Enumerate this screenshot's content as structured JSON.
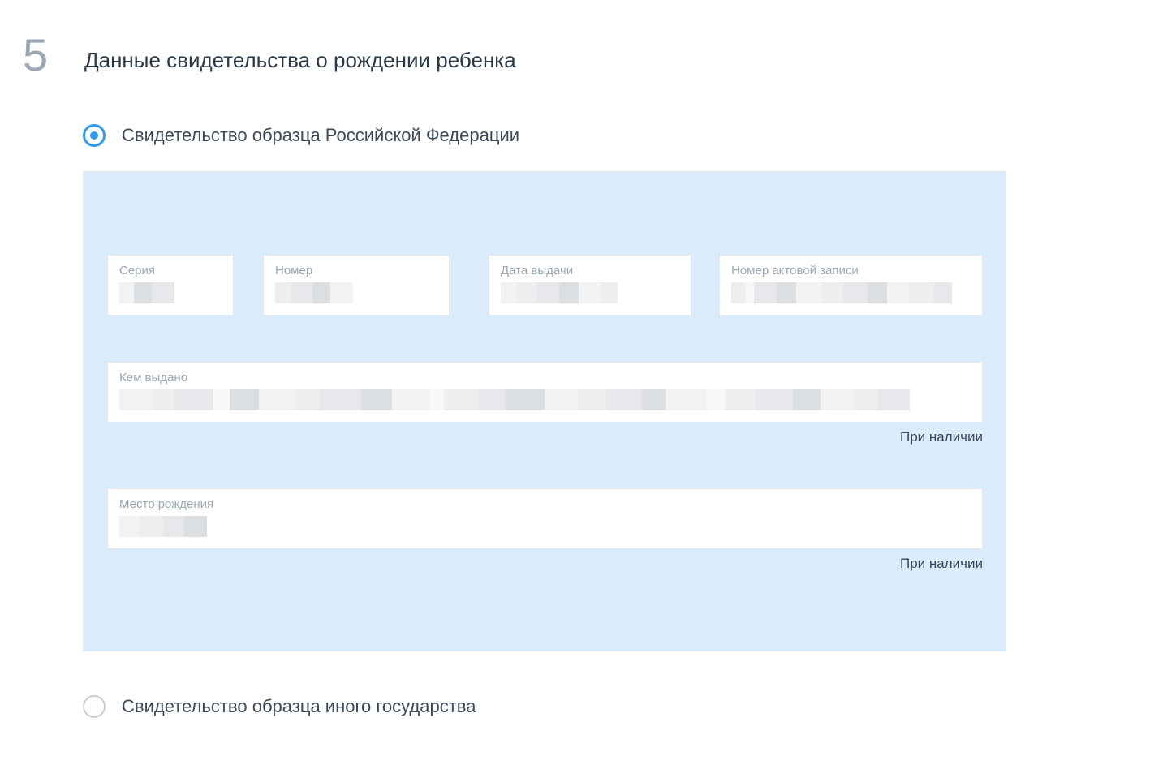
{
  "step": {
    "number": "5",
    "title": "Данные свидетельства о рождении ребенка"
  },
  "radios": {
    "option1_label": "Свидетельство образца Российской Федерации",
    "option2_label": "Свидетельство образца иного государства"
  },
  "fields": {
    "series": {
      "label": "Серия"
    },
    "number": {
      "label": "Номер"
    },
    "issue_date": {
      "label": "Дата выдачи"
    },
    "record_number": {
      "label": "Номер актовой записи"
    },
    "issued_by": {
      "label": "Кем выдано",
      "help": "При наличии"
    },
    "birth_place": {
      "label": "Место рождения",
      "help": "При наличии"
    }
  }
}
